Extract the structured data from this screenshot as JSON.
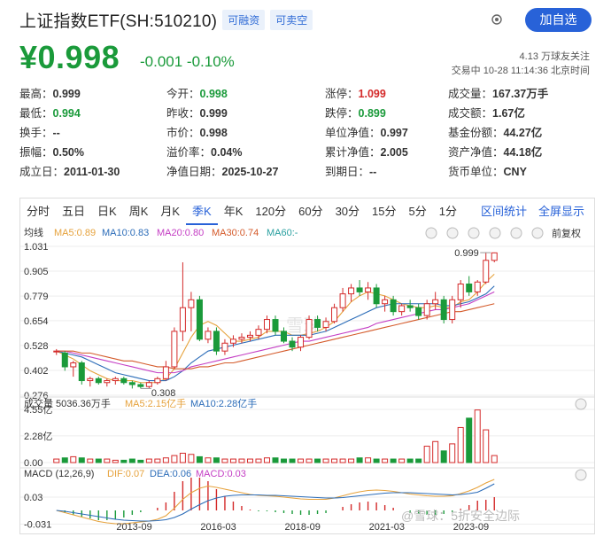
{
  "header": {
    "title": "上证指数ETF(SH:510210)",
    "tags": [
      "可融资",
      "可卖空"
    ],
    "add_button": "加自选",
    "price": "¥0.998",
    "change": "-0.001  -0.10%",
    "followers": "4.13 万球友关注",
    "trade_status": "交易中 10-28 11:14:36 北京时间"
  },
  "stats": [
    {
      "label": "最高：",
      "value": "0.999"
    },
    {
      "label": "今开：",
      "value": "0.998"
    },
    {
      "label": "涨停：",
      "value": "1.099"
    },
    {
      "label": "成交量：",
      "value": "167.37万手"
    },
    {
      "label": "最低：",
      "value": "0.994"
    },
    {
      "label": "昨收：",
      "value": "0.999"
    },
    {
      "label": "跌停：",
      "value": "0.899"
    },
    {
      "label": "成交额：",
      "value": "1.67亿"
    },
    {
      "label": "换手：",
      "value": "--"
    },
    {
      "label": "市价：",
      "value": "0.998"
    },
    {
      "label": "单位净值：",
      "value": "0.997"
    },
    {
      "label": "基金份额：",
      "value": "44.27亿"
    },
    {
      "label": "振幅：",
      "value": "0.50%"
    },
    {
      "label": "溢价率：",
      "value": "0.04%"
    },
    {
      "label": "累计净值：",
      "value": "2.005"
    },
    {
      "label": "资产净值：",
      "value": "44.18亿"
    },
    {
      "label": "成立日：",
      "value": "2011-01-30"
    },
    {
      "label": "净值日期：",
      "value": "2025-10-27"
    },
    {
      "label": "到期日：",
      "value": "--"
    },
    {
      "label": "货币单位：",
      "value": "CNY"
    }
  ],
  "colors": {
    "up": "#d42a2a",
    "down": "#1a9a3a",
    "accent": "#2862d8"
  },
  "tabs": [
    "分时",
    "五日",
    "日K",
    "周K",
    "月K",
    "季K",
    "年K",
    "120分",
    "60分",
    "30分",
    "15分",
    "5分",
    "1分"
  ],
  "active_tab": "季K",
  "tab_right": [
    "区间统计",
    "全屏显示"
  ],
  "ma_bar": {
    "label": "均线",
    "ma5": "MA5:0.89",
    "ma10": "MA10:0.83",
    "ma20": "MA20:0.80",
    "ma30": "MA30:0.74",
    "ma60": "MA60:-",
    "fuquan": "前复权"
  },
  "volume_bar": {
    "label": "成交量 5036.36万手",
    "ma5": "MA5:2.15亿手",
    "ma10": "MA10:2.28亿手"
  },
  "macd_bar": {
    "label": "MACD (12,26,9)",
    "dif": "DIF:0.07",
    "dea": "DEA:0.06",
    "macd": "MACD:0.03"
  },
  "watermark": "雪球",
  "source_watermark": "@雪球：5折安全边际",
  "chart_data": {
    "type": "candlestick",
    "y_ticks": [
      "1.031",
      "0.905",
      "0.779",
      "0.654",
      "0.528",
      "0.402",
      "0.276"
    ],
    "ylim": [
      0.276,
      1.031
    ],
    "x_ticks": [
      "2013-09",
      "2016-03",
      "2018-09",
      "2021-03",
      "2023-09"
    ],
    "annotations": {
      "high_label": "0.999",
      "low_label": "0.308"
    },
    "volume_ticks": [
      "4.55亿",
      "2.28亿",
      "0.00"
    ],
    "macd_ticks": [
      "0.03",
      "-0.031"
    ],
    "candles": [
      {
        "o": 0.5,
        "h": 0.51,
        "l": 0.48,
        "c": 0.5
      },
      {
        "o": 0.49,
        "h": 0.5,
        "l": 0.4,
        "c": 0.42
      },
      {
        "o": 0.42,
        "h": 0.45,
        "l": 0.37,
        "c": 0.44
      },
      {
        "o": 0.44,
        "h": 0.45,
        "l": 0.33,
        "c": 0.35
      },
      {
        "o": 0.35,
        "h": 0.37,
        "l": 0.32,
        "c": 0.36
      },
      {
        "o": 0.36,
        "h": 0.37,
        "l": 0.33,
        "c": 0.34
      },
      {
        "o": 0.34,
        "h": 0.36,
        "l": 0.32,
        "c": 0.35
      },
      {
        "o": 0.35,
        "h": 0.37,
        "l": 0.33,
        "c": 0.36
      },
      {
        "o": 0.36,
        "h": 0.37,
        "l": 0.33,
        "c": 0.34
      },
      {
        "o": 0.34,
        "h": 0.35,
        "l": 0.31,
        "c": 0.33
      },
      {
        "o": 0.33,
        "h": 0.34,
        "l": 0.31,
        "c": 0.32
      },
      {
        "o": 0.32,
        "h": 0.35,
        "l": 0.31,
        "c": 0.34
      },
      {
        "o": 0.34,
        "h": 0.37,
        "l": 0.33,
        "c": 0.36
      },
      {
        "o": 0.36,
        "h": 0.45,
        "l": 0.35,
        "c": 0.42
      },
      {
        "o": 0.42,
        "h": 0.62,
        "l": 0.41,
        "c": 0.6
      },
      {
        "o": 0.6,
        "h": 0.95,
        "l": 0.55,
        "c": 0.72
      },
      {
        "o": 0.72,
        "h": 0.8,
        "l": 0.6,
        "c": 0.76
      },
      {
        "o": 0.76,
        "h": 0.78,
        "l": 0.55,
        "c": 0.56
      },
      {
        "o": 0.56,
        "h": 0.62,
        "l": 0.54,
        "c": 0.6
      },
      {
        "o": 0.6,
        "h": 0.62,
        "l": 0.48,
        "c": 0.5
      },
      {
        "o": 0.5,
        "h": 0.56,
        "l": 0.48,
        "c": 0.54
      },
      {
        "o": 0.54,
        "h": 0.58,
        "l": 0.52,
        "c": 0.56
      },
      {
        "o": 0.56,
        "h": 0.59,
        "l": 0.54,
        "c": 0.57
      },
      {
        "o": 0.57,
        "h": 0.6,
        "l": 0.55,
        "c": 0.58
      },
      {
        "o": 0.58,
        "h": 0.63,
        "l": 0.56,
        "c": 0.61
      },
      {
        "o": 0.61,
        "h": 0.68,
        "l": 0.59,
        "c": 0.66
      },
      {
        "o": 0.66,
        "h": 0.68,
        "l": 0.58,
        "c": 0.6
      },
      {
        "o": 0.6,
        "h": 0.62,
        "l": 0.54,
        "c": 0.55
      },
      {
        "o": 0.55,
        "h": 0.57,
        "l": 0.5,
        "c": 0.52
      },
      {
        "o": 0.52,
        "h": 0.58,
        "l": 0.5,
        "c": 0.57
      },
      {
        "o": 0.57,
        "h": 0.68,
        "l": 0.56,
        "c": 0.66
      },
      {
        "o": 0.66,
        "h": 0.68,
        "l": 0.6,
        "c": 0.62
      },
      {
        "o": 0.62,
        "h": 0.67,
        "l": 0.6,
        "c": 0.65
      },
      {
        "o": 0.65,
        "h": 0.74,
        "l": 0.64,
        "c": 0.72
      },
      {
        "o": 0.72,
        "h": 0.82,
        "l": 0.7,
        "c": 0.79
      },
      {
        "o": 0.79,
        "h": 0.84,
        "l": 0.75,
        "c": 0.82
      },
      {
        "o": 0.82,
        "h": 0.86,
        "l": 0.78,
        "c": 0.8
      },
      {
        "o": 0.8,
        "h": 0.85,
        "l": 0.76,
        "c": 0.82
      },
      {
        "o": 0.82,
        "h": 0.84,
        "l": 0.72,
        "c": 0.74
      },
      {
        "o": 0.74,
        "h": 0.78,
        "l": 0.7,
        "c": 0.76
      },
      {
        "o": 0.76,
        "h": 0.78,
        "l": 0.68,
        "c": 0.7
      },
      {
        "o": 0.7,
        "h": 0.74,
        "l": 0.68,
        "c": 0.73
      },
      {
        "o": 0.73,
        "h": 0.76,
        "l": 0.7,
        "c": 0.72
      },
      {
        "o": 0.72,
        "h": 0.74,
        "l": 0.66,
        "c": 0.68
      },
      {
        "o": 0.68,
        "h": 0.76,
        "l": 0.66,
        "c": 0.74
      },
      {
        "o": 0.74,
        "h": 0.8,
        "l": 0.71,
        "c": 0.76
      },
      {
        "o": 0.76,
        "h": 0.78,
        "l": 0.64,
        "c": 0.66
      },
      {
        "o": 0.66,
        "h": 0.78,
        "l": 0.64,
        "c": 0.76
      },
      {
        "o": 0.76,
        "h": 0.86,
        "l": 0.72,
        "c": 0.84
      },
      {
        "o": 0.84,
        "h": 0.88,
        "l": 0.78,
        "c": 0.8
      },
      {
        "o": 0.8,
        "h": 0.86,
        "l": 0.78,
        "c": 0.85
      },
      {
        "o": 0.85,
        "h": 1.0,
        "l": 0.84,
        "c": 0.96
      },
      {
        "o": 0.96,
        "h": 1.0,
        "l": 0.95,
        "c": 0.998
      }
    ],
    "ma_series": {
      "ma5": [
        0.5,
        0.48,
        0.46,
        0.43,
        0.4,
        0.38,
        0.36,
        0.35,
        0.35,
        0.35,
        0.34,
        0.34,
        0.34,
        0.36,
        0.41,
        0.49,
        0.57,
        0.63,
        0.65,
        0.63,
        0.59,
        0.55,
        0.55,
        0.56,
        0.57,
        0.6,
        0.6,
        0.6,
        0.58,
        0.58,
        0.59,
        0.6,
        0.62,
        0.65,
        0.7,
        0.75,
        0.78,
        0.8,
        0.79,
        0.78,
        0.76,
        0.74,
        0.73,
        0.72,
        0.72,
        0.73,
        0.72,
        0.72,
        0.75,
        0.76,
        0.8,
        0.85,
        0.89
      ],
      "ma10": [
        0.5,
        0.49,
        0.48,
        0.47,
        0.45,
        0.43,
        0.41,
        0.39,
        0.38,
        0.37,
        0.36,
        0.35,
        0.35,
        0.35,
        0.37,
        0.4,
        0.44,
        0.47,
        0.5,
        0.51,
        0.52,
        0.53,
        0.54,
        0.55,
        0.56,
        0.57,
        0.58,
        0.58,
        0.58,
        0.58,
        0.58,
        0.59,
        0.6,
        0.62,
        0.64,
        0.66,
        0.68,
        0.7,
        0.72,
        0.73,
        0.74,
        0.74,
        0.74,
        0.74,
        0.74,
        0.74,
        0.73,
        0.73,
        0.74,
        0.75,
        0.77,
        0.79,
        0.83
      ],
      "ma20": [
        0.5,
        0.5,
        0.49,
        0.48,
        0.47,
        0.46,
        0.45,
        0.44,
        0.43,
        0.42,
        0.41,
        0.4,
        0.39,
        0.39,
        0.39,
        0.4,
        0.42,
        0.43,
        0.44,
        0.45,
        0.46,
        0.47,
        0.48,
        0.49,
        0.5,
        0.51,
        0.52,
        0.53,
        0.54,
        0.55,
        0.55,
        0.56,
        0.57,
        0.58,
        0.59,
        0.6,
        0.61,
        0.62,
        0.64,
        0.65,
        0.66,
        0.67,
        0.68,
        0.69,
        0.7,
        0.71,
        0.71,
        0.72,
        0.73,
        0.74,
        0.76,
        0.78,
        0.8
      ],
      "ma30": [
        0.5,
        0.5,
        0.5,
        0.49,
        0.49,
        0.48,
        0.47,
        0.46,
        0.45,
        0.45,
        0.44,
        0.43,
        0.42,
        0.42,
        0.41,
        0.41,
        0.41,
        0.42,
        0.42,
        0.43,
        0.44,
        0.44,
        0.45,
        0.46,
        0.47,
        0.48,
        0.49,
        0.5,
        0.51,
        0.52,
        0.53,
        0.54,
        0.55,
        0.56,
        0.57,
        0.58,
        0.59,
        0.6,
        0.61,
        0.62,
        0.63,
        0.64,
        0.65,
        0.66,
        0.67,
        0.68,
        0.69,
        0.7,
        0.7,
        0.71,
        0.72,
        0.73,
        0.74
      ]
    },
    "volume": [
      0.3,
      0.4,
      0.5,
      0.4,
      0.3,
      0.3,
      0.3,
      0.2,
      0.2,
      0.3,
      0.2,
      0.3,
      0.3,
      0.4,
      0.6,
      0.8,
      0.7,
      0.5,
      0.4,
      0.4,
      0.3,
      0.3,
      0.3,
      0.3,
      0.3,
      0.4,
      0.4,
      0.3,
      0.3,
      0.3,
      0.3,
      0.3,
      0.3,
      0.3,
      0.3,
      0.3,
      0.4,
      0.4,
      0.3,
      0.3,
      0.3,
      0.3,
      0.3,
      0.3,
      1.4,
      1.8,
      1.0,
      1.6,
      3.0,
      3.8,
      4.5,
      2.8,
      0.6
    ],
    "macd": {
      "dif": [
        0.0,
        -0.005,
        -0.01,
        -0.015,
        -0.02,
        -0.025,
        -0.028,
        -0.03,
        -0.03,
        -0.028,
        -0.026,
        -0.024,
        -0.02,
        -0.012,
        0.005,
        0.025,
        0.04,
        0.05,
        0.055,
        0.052,
        0.048,
        0.044,
        0.04,
        0.036,
        0.034,
        0.033,
        0.032,
        0.03,
        0.028,
        0.026,
        0.025,
        0.025,
        0.025,
        0.028,
        0.033,
        0.038,
        0.042,
        0.045,
        0.046,
        0.045,
        0.043,
        0.04,
        0.037,
        0.035,
        0.033,
        0.032,
        0.032,
        0.033,
        0.038,
        0.044,
        0.052,
        0.062,
        0.07
      ],
      "dea": [
        0.0,
        -0.002,
        -0.005,
        -0.008,
        -0.011,
        -0.014,
        -0.017,
        -0.02,
        -0.022,
        -0.023,
        -0.024,
        -0.024,
        -0.023,
        -0.021,
        -0.016,
        -0.008,
        0.003,
        0.013,
        0.022,
        0.028,
        0.032,
        0.034,
        0.035,
        0.035,
        0.035,
        0.034,
        0.034,
        0.033,
        0.032,
        0.031,
        0.03,
        0.029,
        0.028,
        0.028,
        0.029,
        0.031,
        0.033,
        0.035,
        0.037,
        0.039,
        0.04,
        0.04,
        0.04,
        0.039,
        0.038,
        0.037,
        0.036,
        0.035,
        0.036,
        0.038,
        0.041,
        0.05,
        0.06
      ],
      "hist": [
        0.0,
        -0.006,
        -0.01,
        -0.014,
        -0.018,
        -0.022,
        -0.022,
        -0.02,
        -0.016,
        -0.01,
        -0.004,
        0.0,
        0.006,
        0.018,
        0.042,
        0.066,
        0.074,
        0.074,
        0.066,
        0.048,
        0.032,
        0.02,
        0.01,
        0.002,
        -0.002,
        -0.002,
        -0.004,
        -0.006,
        -0.008,
        -0.01,
        -0.01,
        -0.008,
        -0.006,
        0.0,
        0.008,
        0.014,
        0.018,
        0.02,
        0.018,
        0.012,
        0.006,
        0.0,
        -0.006,
        -0.008,
        -0.01,
        -0.01,
        -0.008,
        -0.004,
        0.004,
        0.012,
        0.022,
        0.024,
        0.03
      ]
    }
  }
}
